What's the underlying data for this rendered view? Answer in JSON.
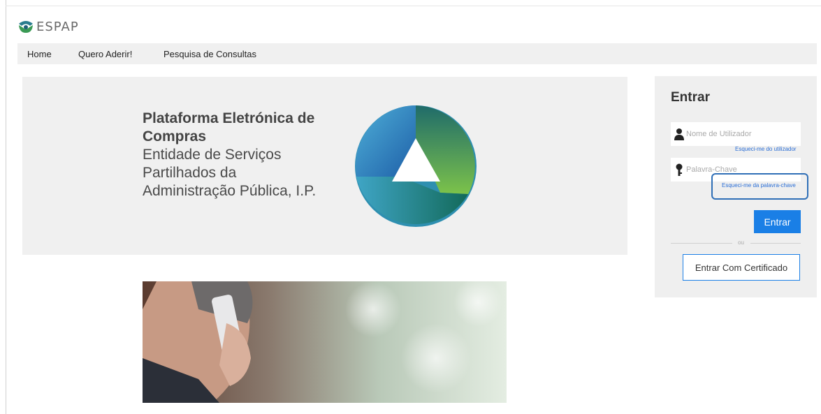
{
  "brand": {
    "name": "ESPAP"
  },
  "nav": {
    "items": [
      {
        "label": "Home"
      },
      {
        "label": "Quero Aderir!"
      },
      {
        "label": "Pesquisa de Consultas"
      }
    ]
  },
  "hero": {
    "title": "Plataforma Eletrónica de Compras",
    "subtitle": "Entidade de Serviços Partilhados da Administração Pública, I.P."
  },
  "login": {
    "title": "Entrar",
    "username_placeholder": "Nome de Utilizador",
    "forgot_username": "Esqueci-me do utilizador",
    "password_placeholder": "Palavra-Chave",
    "forgot_password": "Esqueci-me da palavra-chave",
    "submit_label": "Entrar",
    "or_label": "ou",
    "certificate_label": "Entrar Com Certificado"
  },
  "colors": {
    "accent": "#1a7fe6",
    "highlight_border": "#2f6fb7",
    "panel_bg": "#efefef"
  },
  "icons": {
    "user": "user-icon",
    "key": "key-icon"
  }
}
